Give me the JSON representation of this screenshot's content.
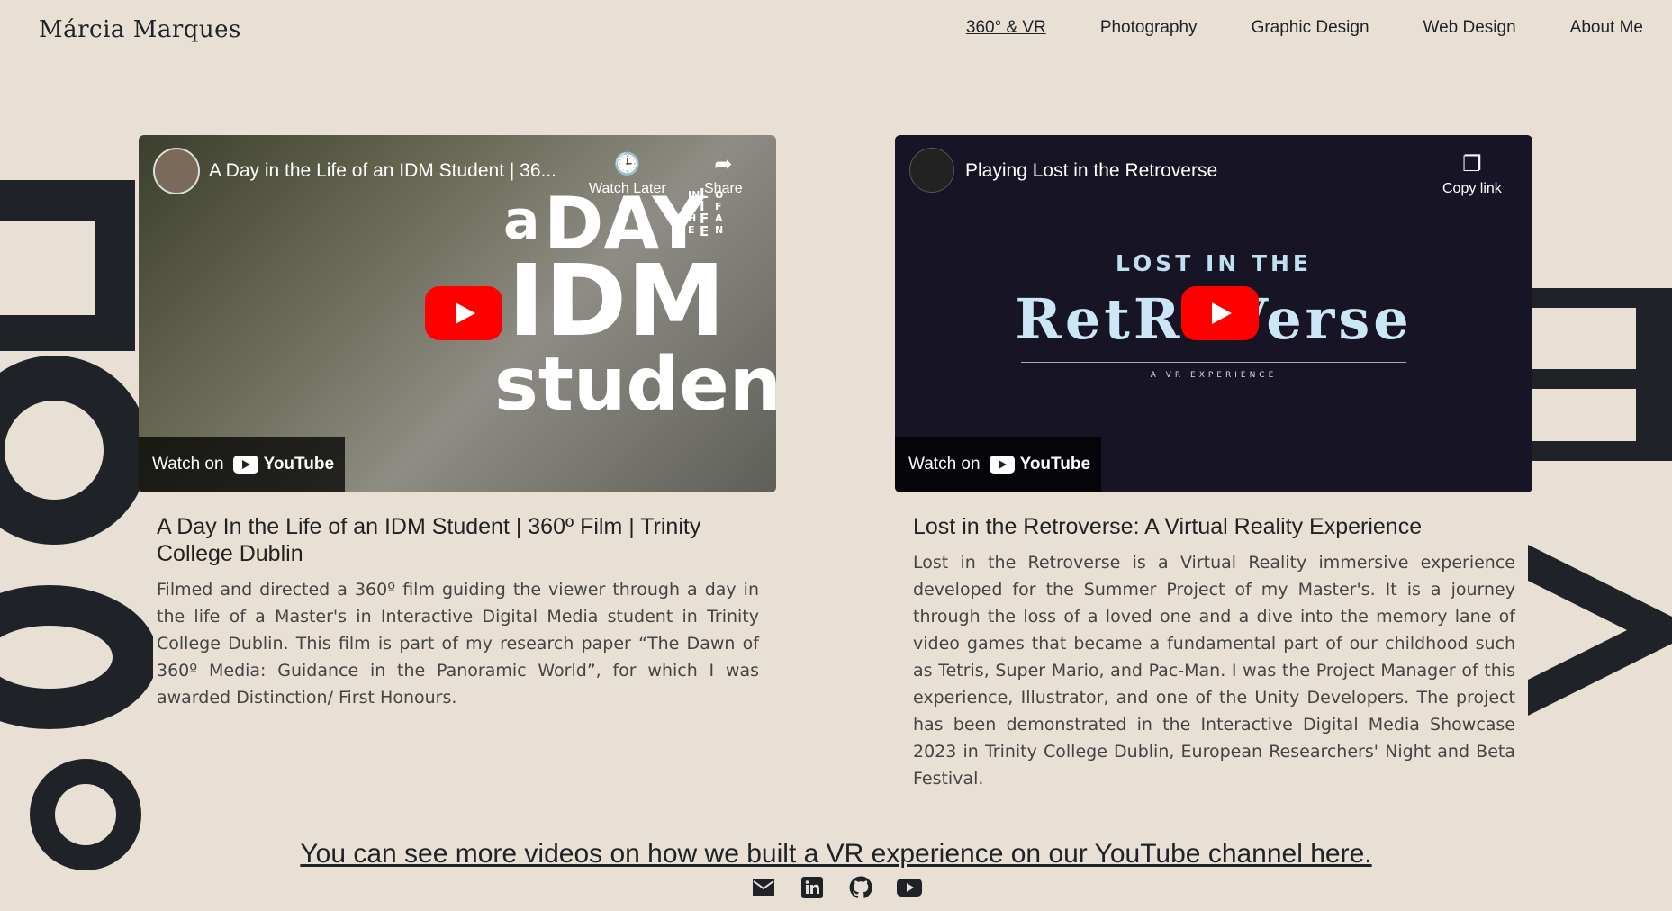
{
  "brand": "Márcia Marques",
  "nav": [
    "360° & VR",
    "Photography",
    "Graphic Design",
    "Web Design",
    "About Me"
  ],
  "videos": [
    {
      "title": "A Day in the Life of an IDM Student | 36...",
      "watch_later": "Watch Later",
      "share": "Share",
      "watch_on": "Watch on",
      "overlay_a": "a",
      "overlay_day": "DAY",
      "overlay_in_the": "IN THE",
      "overlay_life": "LIFE",
      "overlay_of_an": "OF AN",
      "overlay_idm": "IDM",
      "overlay_student": "student",
      "card_title": "A Day In the Life of an IDM Student | 360º Film | Trinity College Dublin",
      "card_desc": "Filmed and directed a 360º film guiding the viewer through a day in the life of a Master's in Interactive Digital Media student in Trinity College Dublin. This film is part of my research paper “The Dawn of 360º Media: Guidance in the Panoramic World”, for which I was awarded Distinction/ First Honours."
    },
    {
      "title": "Playing Lost in the Retroverse",
      "copy_link": "Copy link",
      "watch_on": "Watch on",
      "poster_top": "LOST IN THE",
      "poster_main": "RetRoVerse",
      "poster_sub": "A VR EXPERIENCE",
      "card_title": "Lost in the Retroverse: A Virtual Reality Experience",
      "card_desc": "Lost in the Retroverse is a Virtual Reality immersive experience developed for the Summer Project of my Master's. It is a journey through the loss of a loved one and a dive into the memory lane of video games that became a fundamental part of our childhood such as Tetris, Super Mario, and Pac-Man. I was the Project Manager of this experience, Illustrator, and one of the Unity Developers. The project has been demonstrated in the Interactive Digital Media Showcase 2023 in Trinity College Dublin, European Researchers' Night and Beta Festival."
    }
  ],
  "bottom_link": "You can see more videos on how we built a VR experience on our YouTube channel here.",
  "youtube_wordmark": "YouTube",
  "icons": [
    "mail-icon",
    "linkedin-icon",
    "github-icon",
    "youtube-icon"
  ]
}
